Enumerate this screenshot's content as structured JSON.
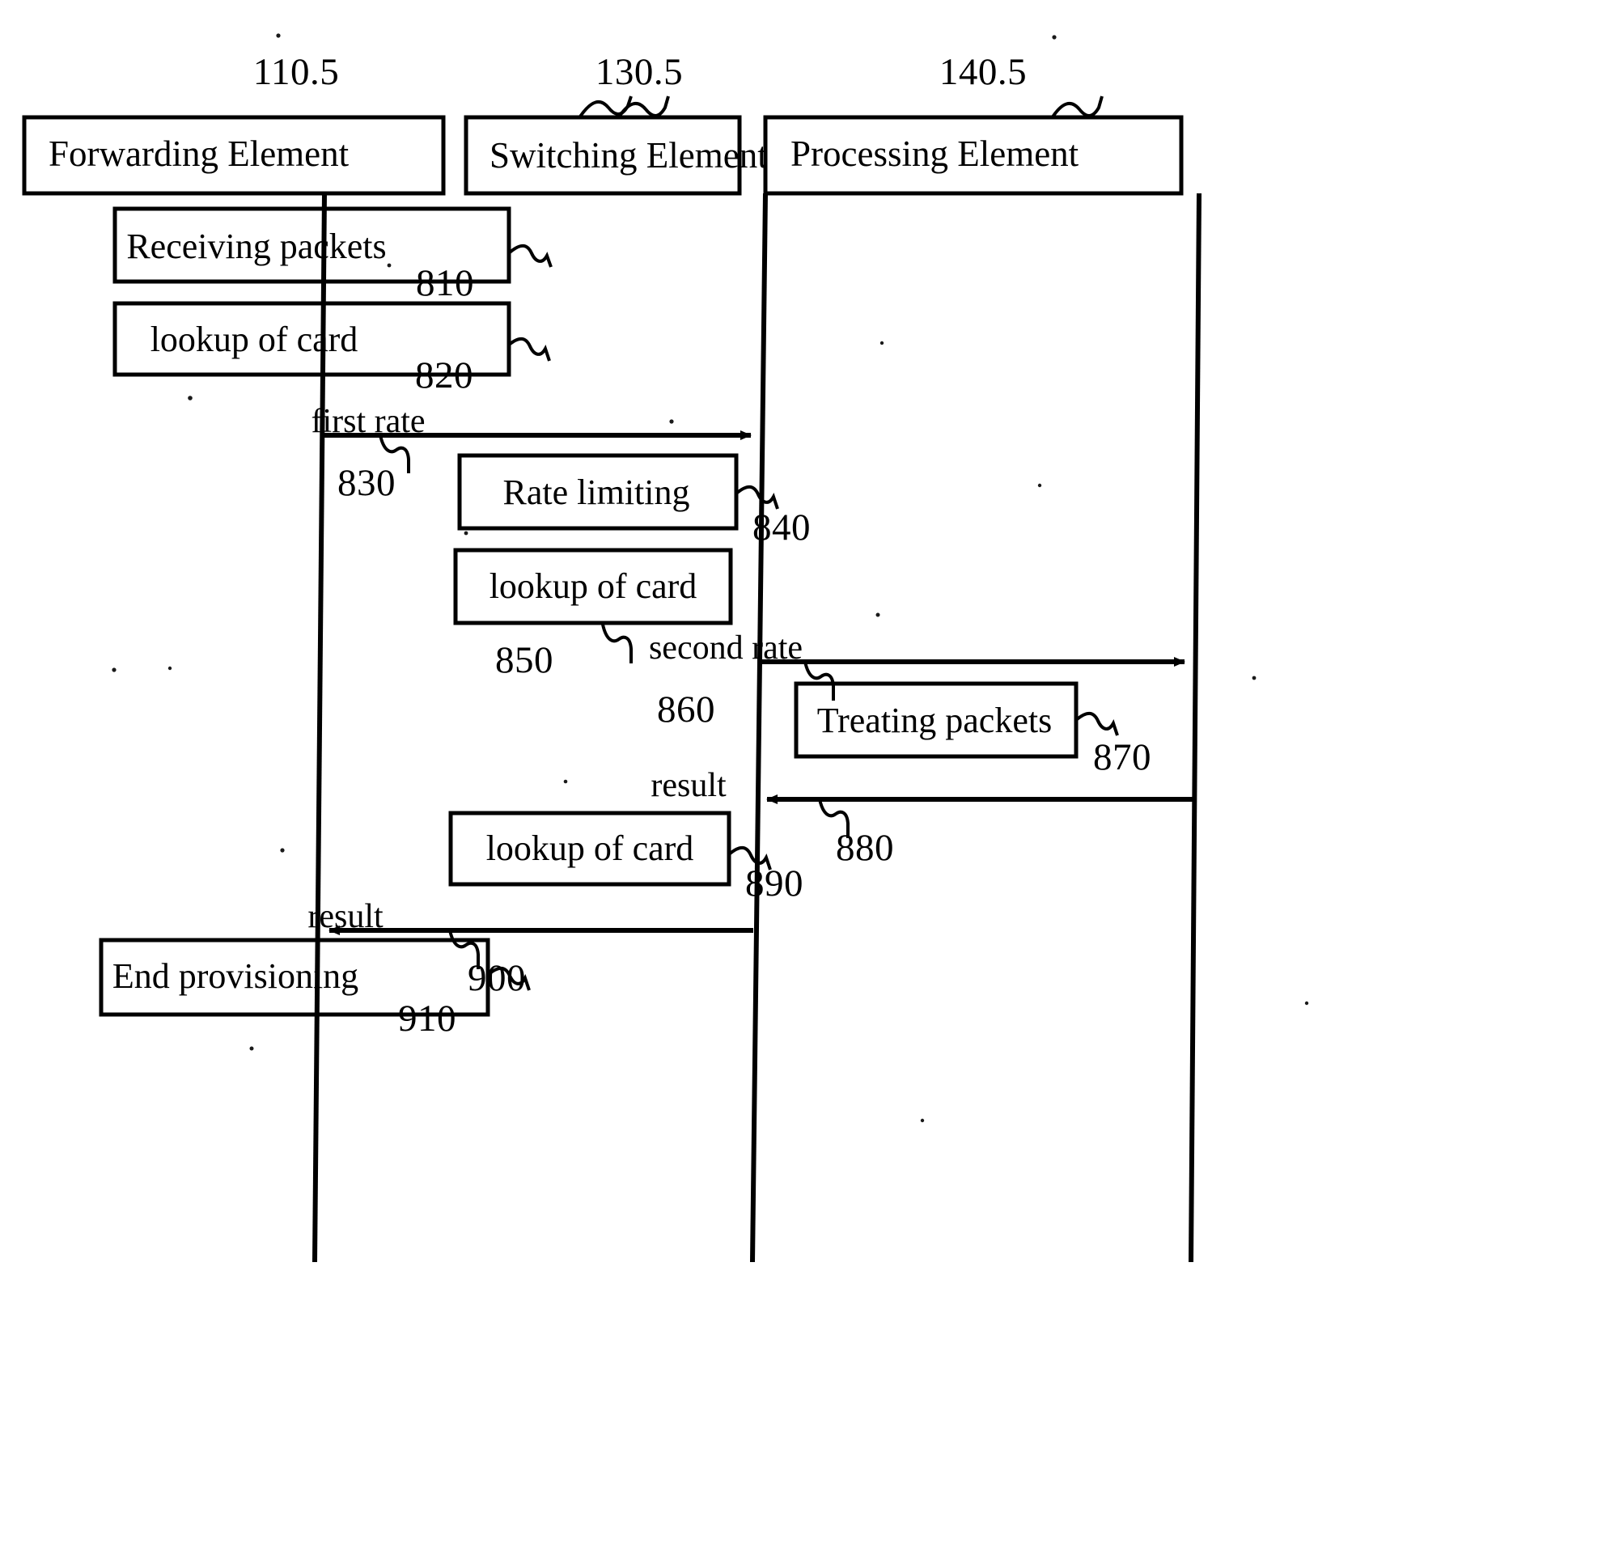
{
  "figure": {
    "type": "patent-sequence-diagram",
    "background_color": "#ffffff",
    "line_color": "#000000"
  },
  "lifelines": [
    {
      "id": "forwarding",
      "header_label": "Forwarding Element",
      "reference_numeral": "110.5"
    },
    {
      "id": "switching",
      "header_label": "Switching Element",
      "reference_numeral": "130.5"
    },
    {
      "id": "processing",
      "header_label": "Processing Element",
      "reference_numeral": "140.5"
    }
  ],
  "activities": [
    {
      "id": "a810",
      "lane": "forwarding",
      "label": "Receiving packets",
      "reference_numeral": "810"
    },
    {
      "id": "a820",
      "lane": "forwarding",
      "label": "lookup of card",
      "reference_numeral": "820"
    },
    {
      "id": "a840",
      "lane": "switching",
      "label": "Rate limiting",
      "reference_numeral": "840"
    },
    {
      "id": "a850",
      "lane": "switching",
      "label": "lookup of card",
      "reference_numeral": "850"
    },
    {
      "id": "a870",
      "lane": "processing",
      "label": "Treating packets",
      "reference_numeral": "870"
    },
    {
      "id": "a890",
      "lane": "switching",
      "label": "lookup of card",
      "reference_numeral": "890"
    },
    {
      "id": "a910",
      "lane": "forwarding",
      "label": "End provisioning",
      "reference_numeral": "910"
    }
  ],
  "messages": [
    {
      "id": "m830",
      "label": "first rate",
      "from": "forwarding",
      "to": "switching",
      "direction": "right",
      "reference_numeral": "830"
    },
    {
      "id": "m860",
      "label": "second rate",
      "from": "switching",
      "to": "processing",
      "direction": "right",
      "reference_numeral": "860"
    },
    {
      "id": "m880",
      "label": "result",
      "from": "processing",
      "to": "switching",
      "direction": "left",
      "reference_numeral": "880"
    },
    {
      "id": "m900",
      "label": "result",
      "from": "switching",
      "to": "forwarding",
      "direction": "left",
      "reference_numeral": "900"
    }
  ]
}
